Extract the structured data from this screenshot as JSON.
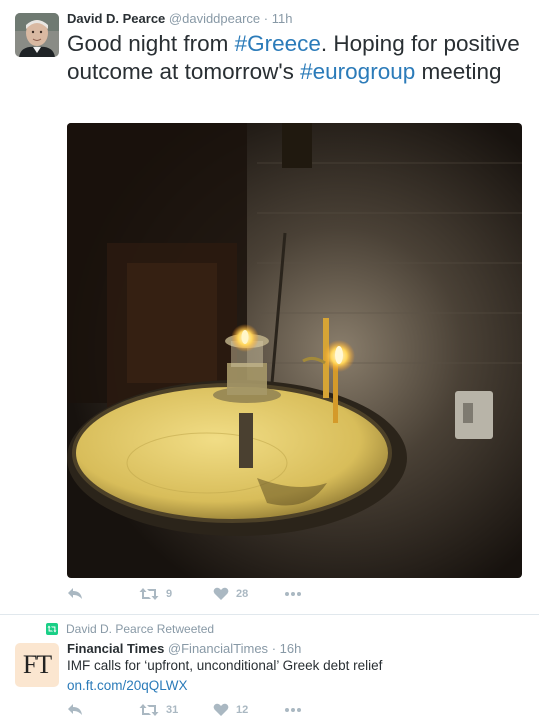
{
  "tweet1": {
    "fullname": "David D. Pearce",
    "handle": "@daviddpearce",
    "dot": "·",
    "time": "11h",
    "text_part1": "Good night from ",
    "hashtag1": "#Greece",
    "text_part2": ". Hoping for positive outcome at tomorrow's ",
    "hashtag2": "#eurogroup",
    "text_part3": " meeting",
    "retweets": "9",
    "likes": "28"
  },
  "tweet2": {
    "retweeted_by": "David D. Pearce Retweeted",
    "fullname": "Financial Times",
    "handle": "@FinancialTimes",
    "dot": "·",
    "time": "16h",
    "avatar_text": "FT",
    "text": "IMF calls for ‘upfront, unconditional’ Greek debt relief",
    "link": "on.ft.com/20qQLWX",
    "retweets": "31",
    "likes": "12"
  },
  "icons": [
    "reply-icon",
    "retweet-icon",
    "heart-icon",
    "more-icon",
    "retweeted-icon"
  ],
  "colors": {
    "hashtag": "#2b7bb9",
    "action_grey": "#aab8c2",
    "retweet_green": "#19cf86",
    "meta_grey": "#8899a6"
  }
}
